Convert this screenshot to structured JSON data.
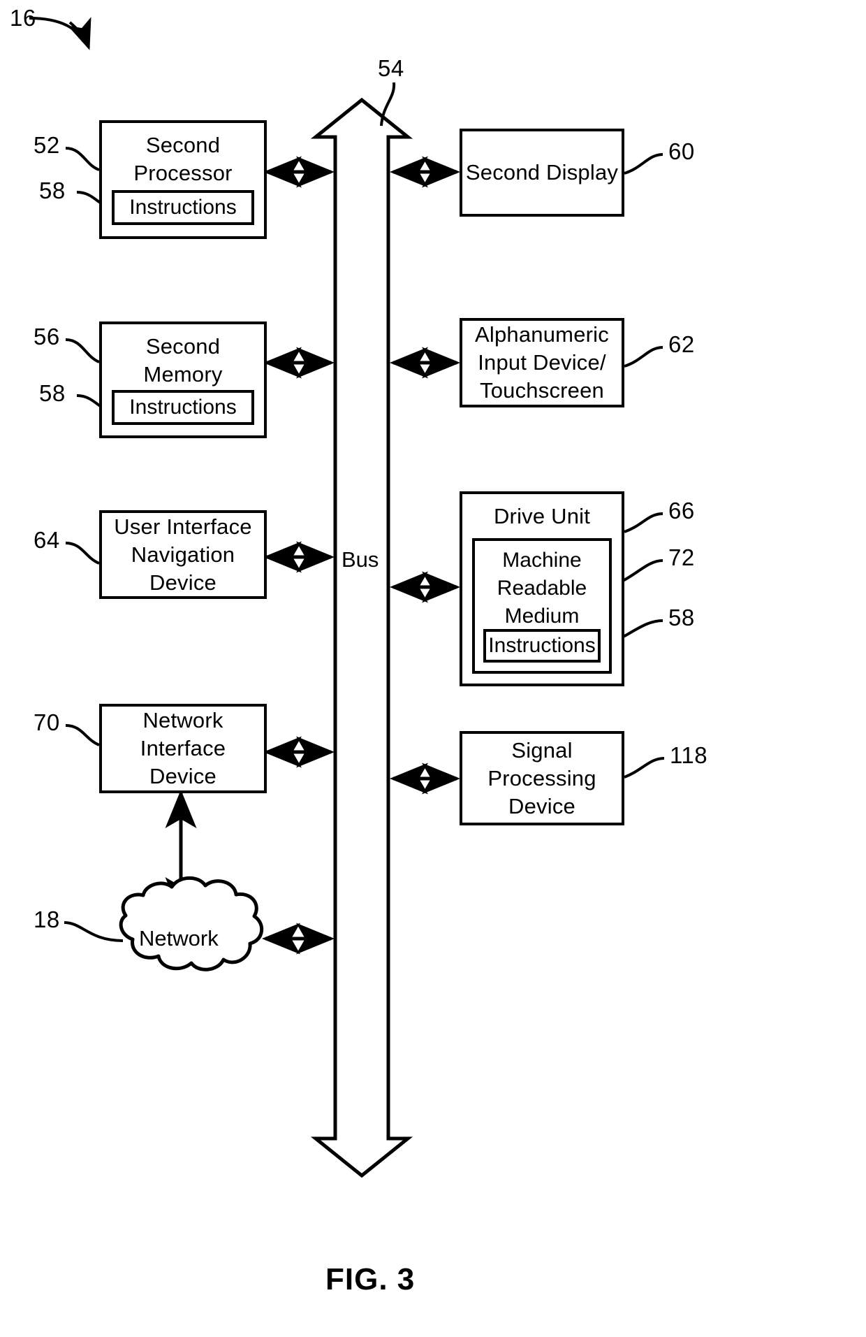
{
  "figure": {
    "caption": "FIG. 3",
    "system_ref": "16"
  },
  "bus": {
    "label": "Bus",
    "ref": "54"
  },
  "left_column": [
    {
      "label": "Second\nProcessor",
      "ref": "52",
      "inner": {
        "label": "Instructions",
        "ref": "58"
      }
    },
    {
      "label": "Second\nMemory",
      "ref": "56",
      "inner": {
        "label": "Instructions",
        "ref": "58"
      }
    },
    {
      "label": "User Interface\nNavigation\nDevice",
      "ref": "64",
      "inner": null
    },
    {
      "label": "Network\nInterface\nDevice",
      "ref": "70",
      "inner": null
    }
  ],
  "right_column": [
    {
      "label": "Second Display",
      "ref": "60",
      "inner": null
    },
    {
      "label": "Alphanumeric\nInput Device/\nTouchscreen",
      "ref": "62",
      "inner": null
    },
    {
      "label": "Drive Unit",
      "ref": "66",
      "inner": {
        "label": "Machine\nReadable\nMedium",
        "ref": "72",
        "inner": {
          "label": "Instructions",
          "ref": "58"
        }
      }
    },
    {
      "label": "Signal\nProcessing\nDevice",
      "ref": "118",
      "inner": null
    }
  ],
  "cloud": {
    "label": "Network",
    "ref": "18"
  }
}
